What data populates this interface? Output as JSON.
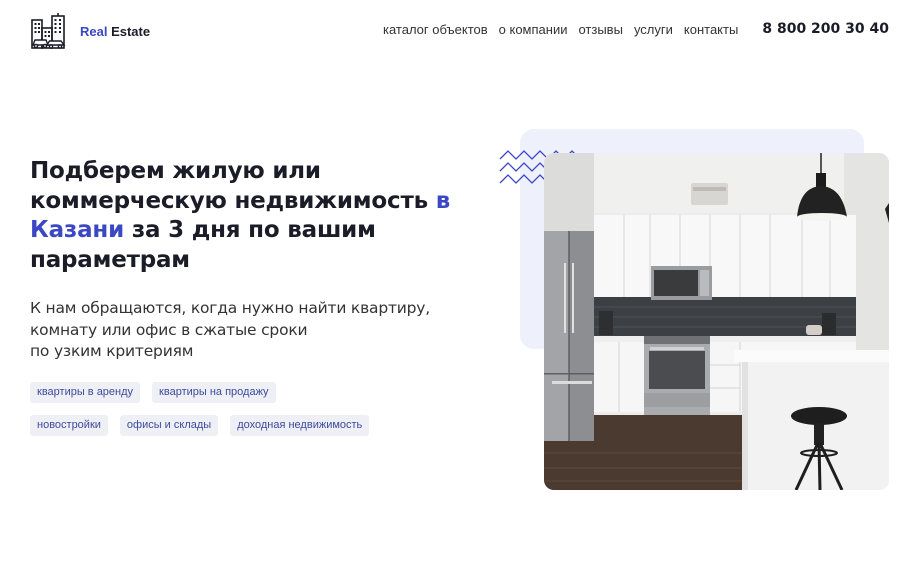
{
  "header": {
    "logo": {
      "brand_first": "Real",
      "brand_second": " Estate",
      "icon": "city-buildings-icon"
    },
    "nav": [
      {
        "label": "каталог объектов"
      },
      {
        "label": "о компании"
      },
      {
        "label": "отзывы"
      },
      {
        "label": "услуги"
      },
      {
        "label": "контакты"
      }
    ],
    "phone": "8 800 200 30 40"
  },
  "hero": {
    "headline_part1": "Подберем жилую или коммерческую недвижимость ",
    "headline_highlight": "в Казани",
    "headline_part2": " за 3 дня по вашим параметрам",
    "subtext_line1": "К нам обращаются, когда нужно найти квартиру,",
    "subtext_line2": "комнату или офис в сжатые сроки",
    "subtext_line3": "по узким критериям",
    "tags_row1": [
      "квартиры в аренду",
      "квартиры на продажу"
    ],
    "tags_row2": [
      "новостройки",
      "офисы и склады",
      "доходная недвижимость"
    ]
  },
  "image": {
    "subject": "kitchen-photo",
    "decoration": "zigzag-lines-icon"
  },
  "colors": {
    "accent": "#3b48c4",
    "tag_bg": "#eef0f6",
    "tag_text": "#3d4a9c",
    "panel_bg": "#eef0fb"
  }
}
